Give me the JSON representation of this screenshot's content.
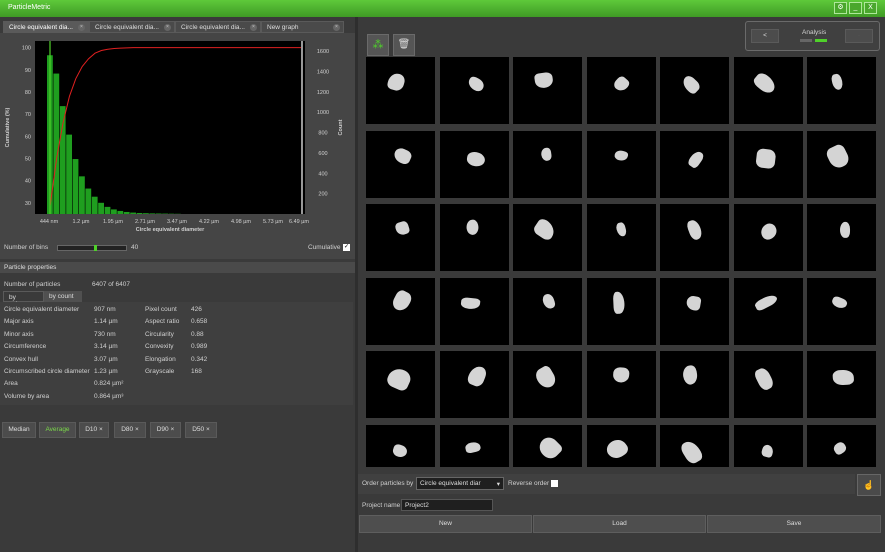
{
  "app": {
    "title": "ParticleMetric"
  },
  "tabs": [
    {
      "label": "Circle equivalent dia..."
    },
    {
      "label": "Circle equivalent dia..."
    },
    {
      "label": "Circle equivalent dia..."
    },
    {
      "label": "New graph"
    }
  ],
  "chart_data": {
    "type": "bar",
    "xlabel": "Circle equivalent diameter",
    "ylabel_left": "Cumulative (%)",
    "ylabel_right": "Count",
    "xticks": [
      "444 nm",
      "1.2 µm",
      "1.95 µm",
      "2.71 µm",
      "3.47 µm",
      "4.22 µm",
      "4.98 µm",
      "5.73 µm",
      "6.49 µm"
    ],
    "yticks_left": [
      "100",
      "90",
      "80",
      "70",
      "60",
      "50",
      "40",
      "30"
    ],
    "yticks_right": [
      "1600",
      "1400",
      "1200",
      "1000",
      "800",
      "600",
      "400",
      "200"
    ],
    "ylim_left": [
      25,
      103
    ],
    "ylim_right": [
      0,
      1700
    ],
    "counts": [
      1560,
      1380,
      1060,
      780,
      540,
      370,
      250,
      170,
      110,
      70,
      45,
      30,
      20,
      14,
      10,
      8,
      6,
      5,
      4,
      3,
      2
    ],
    "cumulative": [
      29,
      50,
      66,
      78,
      86,
      91.5,
      95,
      97.5,
      98.7,
      99.3,
      99.6,
      99.8,
      99.9,
      100,
      100,
      100,
      100,
      100,
      100,
      100,
      100
    ],
    "colors": {
      "bars": "#1f9e1f",
      "cumulative": "#e02020",
      "marker": "#ffffff"
    }
  },
  "bins": {
    "label": "Number of bins",
    "value": "40",
    "cumulative_label": "Cumulative",
    "cumulative_checked": true,
    "slider_fraction": 0.55
  },
  "props": {
    "header": "Particle properties",
    "count_label": "Number of particles",
    "count_value": "6407 of 6407",
    "tabs": [
      "by volume",
      "by count"
    ],
    "left": [
      {
        "k": "Circle equivalent diameter",
        "v": "907 nm"
      },
      {
        "k": "Major axis",
        "v": "1.14 µm"
      },
      {
        "k": "Minor axis",
        "v": "730 nm"
      },
      {
        "k": "Circumference",
        "v": "3.14 µm"
      },
      {
        "k": "Convex hull",
        "v": "3.07 µm"
      },
      {
        "k": "Circumscribed circle diameter",
        "v": "1.23 µm"
      },
      {
        "k": "Area",
        "v": "0.824 µm²"
      },
      {
        "k": "Volume by area",
        "v": "0.864 µm³"
      }
    ],
    "right": [
      {
        "k": "Pixel count",
        "v": "426"
      },
      {
        "k": "Aspect ratio",
        "v": "0.658"
      },
      {
        "k": "Circularity",
        "v": "0.88"
      },
      {
        "k": "Convexity",
        "v": "0.989"
      },
      {
        "k": "Elongation",
        "v": "0.342"
      },
      {
        "k": "Grayscale",
        "v": "168"
      }
    ]
  },
  "stats": {
    "median": "Median",
    "average": "Average",
    "d10": "D10",
    "d80": "D80",
    "d90": "D90",
    "d50": "D50",
    "close": "×"
  },
  "toolbar": {
    "sparkle_icon": "particles-icon",
    "trash_icon": "trash-icon"
  },
  "analysis": {
    "label": "Analysis",
    "prev": "<",
    "next": "-"
  },
  "order": {
    "label": "Order particles by",
    "value": "Circle equivalent diar",
    "reverse_label": "Reverse order"
  },
  "project": {
    "label": "Project name",
    "value": "Project2",
    "new": "New",
    "load": "Load",
    "save": "Save"
  }
}
